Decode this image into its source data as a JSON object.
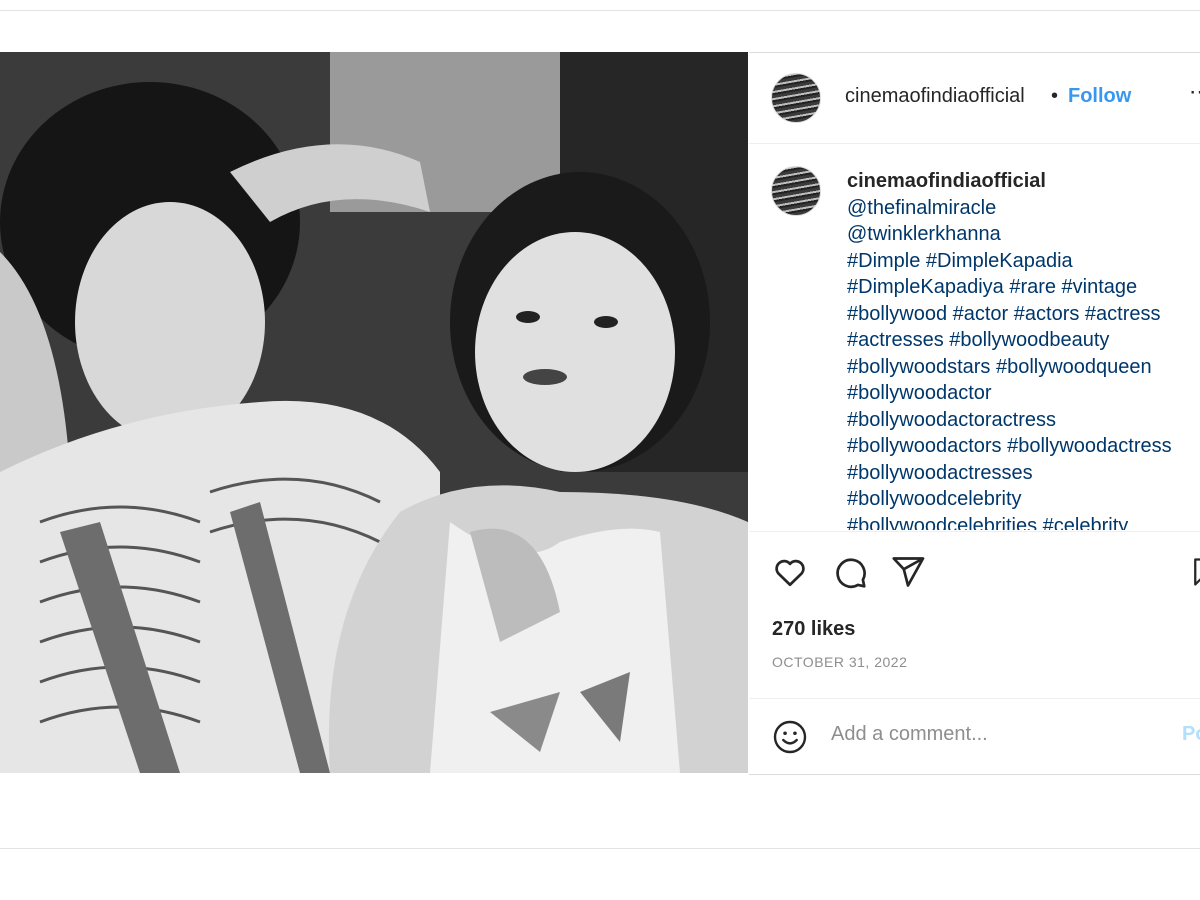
{
  "post": {
    "username": "cinemaofindiaofficial",
    "separator": "•",
    "follow_label": "Follow",
    "more_label": "•••",
    "caption_lines": [
      "@thefinalmiracle",
      "@twinklerkhanna",
      "#Dimple #DimpleKapadia",
      "#DimpleKapadiya #rare #vintage",
      "#bollywood #actor #actors #actress",
      "#actresses #bollywoodbeauty",
      "#bollywoodstars #bollywoodqueen",
      "#bollywoodactor",
      "#bollywoodactoractress",
      "#bollywoodactors #bollywoodactress",
      "#bollywoodactresses",
      "#bollywoodcelebrity",
      "#bollywoodcelebrities #celebrity"
    ],
    "likes": "270 likes",
    "date": "OCTOBER 31, 2022",
    "comment_placeholder": "Add a comment...",
    "post_button": "Post"
  },
  "icons": {
    "like": "heart-icon",
    "comment": "comment-bubble-icon",
    "share": "paper-plane-icon",
    "save": "bookmark-icon",
    "emoji": "smiley-icon"
  },
  "colors": {
    "link": "#00376b",
    "follow": "#3897f0",
    "muted": "#8e8e8e",
    "post_button": "#b2dffc"
  }
}
